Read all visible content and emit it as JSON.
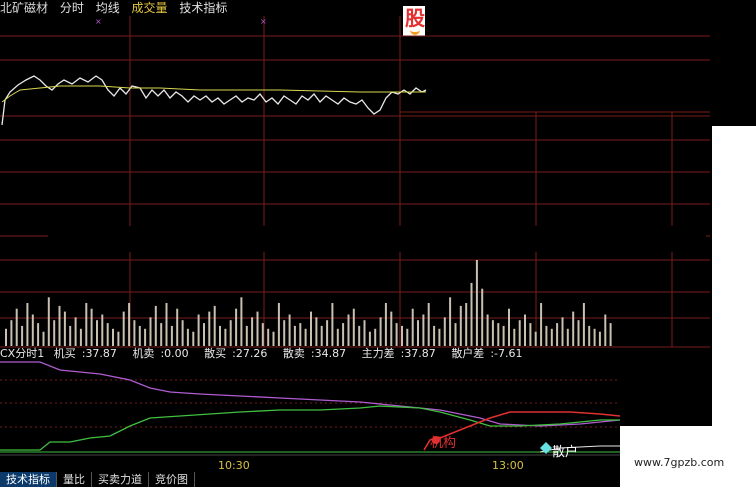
{
  "header": {
    "stock_name": "北矿磁材",
    "menu": [
      "分时",
      "均线",
      "成交量",
      "技术指标"
    ]
  },
  "logo": {
    "char": "股"
  },
  "indicator_legend": {
    "name": "CX分时1",
    "items": [
      {
        "label": "机买",
        "value": "37.87"
      },
      {
        "label": "机卖",
        "value": "0.00"
      },
      {
        "label": "散买",
        "value": "27.26"
      },
      {
        "label": "散卖",
        "value": "34.87"
      },
      {
        "label": "主力差",
        "value": "37.87"
      },
      {
        "label": "散户差",
        "value": "-7.61"
      }
    ]
  },
  "chart_data": {
    "type": "line",
    "x_ticks": [
      "10:30",
      "13:00"
    ],
    "annotations": [
      "机构",
      "散户"
    ],
    "volume_bars": [
      12,
      18,
      26,
      14,
      30,
      22,
      16,
      10,
      34,
      18,
      28,
      24,
      14,
      20,
      12,
      30,
      26,
      18,
      22,
      16,
      12,
      10,
      24,
      30,
      18,
      14,
      12,
      20,
      28,
      16,
      30,
      14,
      26,
      18,
      12,
      10,
      22,
      16,
      24,
      28,
      14,
      12,
      18,
      26,
      34,
      14,
      20,
      24,
      16,
      12,
      10,
      30,
      18,
      22,
      14,
      16,
      12,
      24,
      20,
      14,
      18,
      30,
      12,
      16,
      22,
      26,
      14,
      18,
      10,
      12,
      20,
      30,
      24,
      16,
      14,
      12,
      26,
      18,
      22,
      30,
      14,
      12,
      20,
      34,
      16,
      28,
      30,
      44,
      60,
      40,
      22,
      18,
      16,
      14,
      26,
      12,
      18,
      22,
      16,
      10,
      30,
      14,
      12,
      16,
      20,
      12,
      24,
      18,
      30,
      14,
      12,
      10,
      22,
      16
    ]
  },
  "tabs": [
    "技术指标",
    "量比",
    "买卖力道",
    "竞价图"
  ],
  "colors": {
    "price": "#e8e8e8",
    "avg": "#d8d850",
    "purple": "#b05cd0",
    "green": "#40c040",
    "red": "#e03030",
    "grid": "#7a1c1c"
  },
  "watermark": "www.7gpzb.com"
}
